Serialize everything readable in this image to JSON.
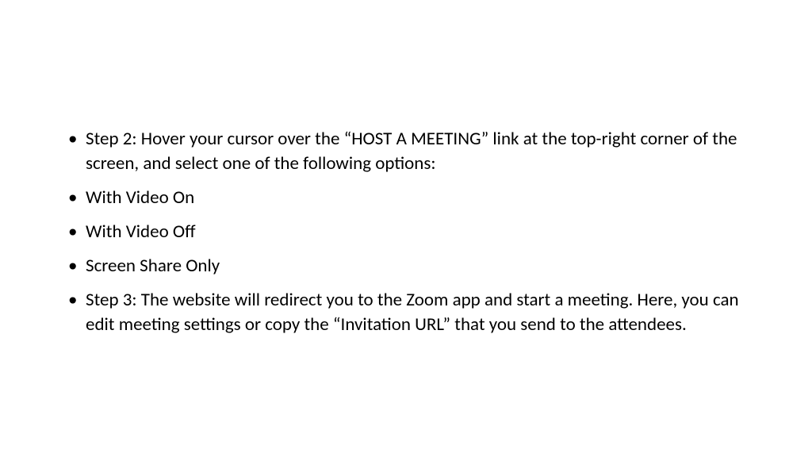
{
  "bullets": [
    "Step 2: Hover your cursor over the “HOST A MEETING” link at the top-right corner of the screen, and select one of the following options:",
    "With Video On",
    "With Video Off",
    "Screen Share Only",
    "Step 3: The website will redirect you to the Zoom app and start a meeting. Here, you can edit meeting settings or copy the “Invitation URL” that you send to the attendees."
  ]
}
